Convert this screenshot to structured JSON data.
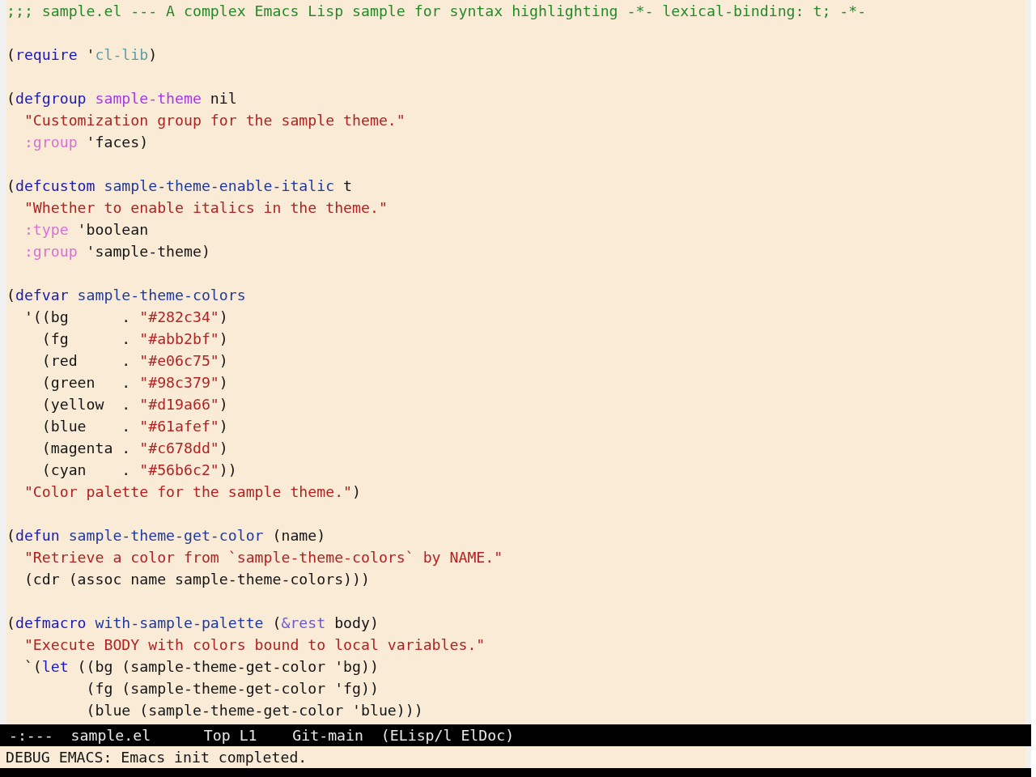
{
  "buffer": {
    "blocks": [
      {
        "lines": [
          {
            "tokens": [
              {
                "kind": "comment",
                "text": ";;; sample.el --- A complex Emacs Lisp sample for syntax highlighting -*- lexical-binding: t; -*-"
              }
            ]
          }
        ]
      },
      {
        "lines": [
          {
            "tokens": [
              {
                "kind": "plain",
                "text": "("
              },
              {
                "kind": "keyword",
                "text": "require"
              },
              {
                "kind": "plain",
                "text": " '"
              },
              {
                "kind": "constant",
                "text": "cl-lib"
              },
              {
                "kind": "plain",
                "text": ")"
              }
            ]
          }
        ]
      },
      {
        "lines": [
          {
            "tokens": [
              {
                "kind": "plain",
                "text": "("
              },
              {
                "kind": "keyword",
                "text": "defgroup"
              },
              {
                "kind": "type",
                "text": " sample-theme"
              },
              {
                "kind": "plain",
                "text": " nil"
              }
            ]
          },
          {
            "tokens": [
              {
                "kind": "string",
                "text": "  \"Customization group for the sample theme.\""
              }
            ]
          },
          {
            "tokens": [
              {
                "kind": "builtin",
                "text": "  :group"
              },
              {
                "kind": "plain",
                "text": " 'faces)"
              }
            ]
          }
        ]
      },
      {
        "lines": [
          {
            "tokens": [
              {
                "kind": "plain",
                "text": "("
              },
              {
                "kind": "keyword",
                "text": "defcustom"
              },
              {
                "kind": "name",
                "text": " sample-theme-enable-italic"
              },
              {
                "kind": "plain",
                "text": " t"
              }
            ]
          },
          {
            "tokens": [
              {
                "kind": "string",
                "text": "  \"Whether to enable italics in the theme.\""
              }
            ]
          },
          {
            "tokens": [
              {
                "kind": "builtin",
                "text": "  :type"
              },
              {
                "kind": "plain",
                "text": " 'boolean"
              }
            ]
          },
          {
            "tokens": [
              {
                "kind": "builtin",
                "text": "  :group"
              },
              {
                "kind": "plain",
                "text": " 'sample-theme)"
              }
            ]
          }
        ]
      },
      {
        "lines": [
          {
            "tokens": [
              {
                "kind": "plain",
                "text": "("
              },
              {
                "kind": "keyword",
                "text": "defvar"
              },
              {
                "kind": "name",
                "text": " sample-theme-colors"
              }
            ]
          },
          {
            "tokens": [
              {
                "kind": "plain",
                "text": "  '((bg      . "
              },
              {
                "kind": "string",
                "text": "\"#282c34\""
              },
              {
                "kind": "plain",
                "text": ")"
              }
            ]
          },
          {
            "tokens": [
              {
                "kind": "plain",
                "text": "    (fg      . "
              },
              {
                "kind": "string",
                "text": "\"#abb2bf\""
              },
              {
                "kind": "plain",
                "text": ")"
              }
            ]
          },
          {
            "tokens": [
              {
                "kind": "plain",
                "text": "    (red     . "
              },
              {
                "kind": "string",
                "text": "\"#e06c75\""
              },
              {
                "kind": "plain",
                "text": ")"
              }
            ]
          },
          {
            "tokens": [
              {
                "kind": "plain",
                "text": "    (green   . "
              },
              {
                "kind": "string",
                "text": "\"#98c379\""
              },
              {
                "kind": "plain",
                "text": ")"
              }
            ]
          },
          {
            "tokens": [
              {
                "kind": "plain",
                "text": "    (yellow  . "
              },
              {
                "kind": "string",
                "text": "\"#d19a66\""
              },
              {
                "kind": "plain",
                "text": ")"
              }
            ]
          },
          {
            "tokens": [
              {
                "kind": "plain",
                "text": "    (blue    . "
              },
              {
                "kind": "string",
                "text": "\"#61afef\""
              },
              {
                "kind": "plain",
                "text": ")"
              }
            ]
          },
          {
            "tokens": [
              {
                "kind": "plain",
                "text": "    (magenta . "
              },
              {
                "kind": "string",
                "text": "\"#c678dd\""
              },
              {
                "kind": "plain",
                "text": ")"
              }
            ]
          },
          {
            "tokens": [
              {
                "kind": "plain",
                "text": "    (cyan    . "
              },
              {
                "kind": "string",
                "text": "\"#56b6c2\""
              },
              {
                "kind": "plain",
                "text": "))"
              }
            ]
          },
          {
            "tokens": [
              {
                "kind": "string",
                "text": "  \"Color palette for the sample theme.\""
              },
              {
                "kind": "plain",
                "text": ")"
              }
            ]
          }
        ]
      },
      {
        "lines": [
          {
            "tokens": [
              {
                "kind": "plain",
                "text": "("
              },
              {
                "kind": "keyword",
                "text": "defun"
              },
              {
                "kind": "name",
                "text": " sample-theme-get-color"
              },
              {
                "kind": "plain",
                "text": " (name)"
              }
            ]
          },
          {
            "tokens": [
              {
                "kind": "string",
                "text": "  \"Retrieve a color from `sample-theme-colors` by NAME.\""
              }
            ]
          },
          {
            "tokens": [
              {
                "kind": "plain",
                "text": "  (cdr (assoc name sample-theme-colors)))"
              }
            ]
          }
        ]
      },
      {
        "lines": [
          {
            "tokens": [
              {
                "kind": "plain",
                "text": "("
              },
              {
                "kind": "keyword",
                "text": "defmacro"
              },
              {
                "kind": "name",
                "text": " with-sample-palette"
              },
              {
                "kind": "plain",
                "text": " ("
              },
              {
                "kind": "argkeyword",
                "text": "&rest"
              },
              {
                "kind": "plain",
                "text": " body)"
              }
            ]
          },
          {
            "tokens": [
              {
                "kind": "string",
                "text": "  \"Execute BODY with colors bound to local variables.\""
              }
            ]
          },
          {
            "tokens": [
              {
                "kind": "plain",
                "text": "  `("
              },
              {
                "kind": "keyword",
                "text": "let"
              },
              {
                "kind": "plain",
                "text": " ((bg (sample-theme-get-color 'bg))"
              }
            ]
          },
          {
            "tokens": [
              {
                "kind": "plain",
                "text": "         (fg (sample-theme-get-color 'fg))"
              }
            ]
          },
          {
            "tokens": [
              {
                "kind": "plain",
                "text": "         (blue (sample-theme-get-color 'blue)))"
              }
            ]
          }
        ]
      }
    ]
  },
  "mode_line": {
    "segments": [
      "-:---",
      "sample.el",
      "Top L1",
      "Git-main",
      "(ELisp/l ElDoc)"
    ]
  },
  "echo_area": {
    "message": "DEBUG EMACS: Emacs init completed."
  }
}
